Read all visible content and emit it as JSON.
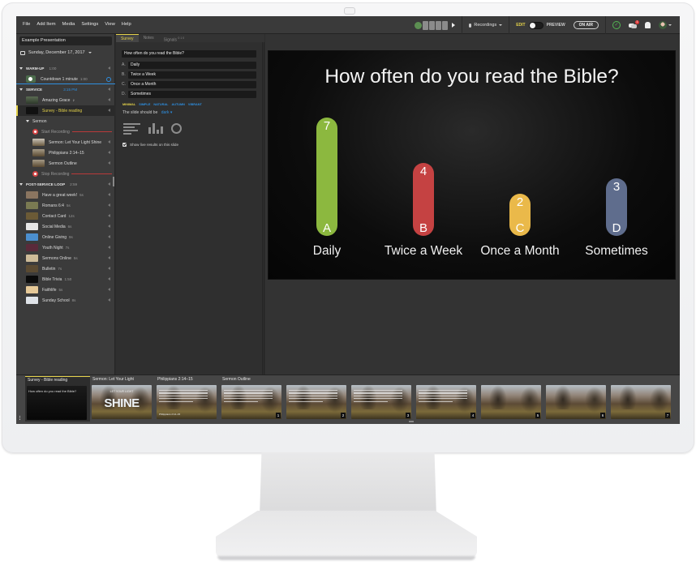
{
  "menu": [
    "File",
    "Add Item",
    "Media",
    "Settings",
    "View",
    "Help"
  ],
  "toolbar": {
    "recordings_label": "Recordings",
    "edit_label": "EDIT",
    "preview_label": "PREVIEW",
    "on_air_label": "ON AIR",
    "notification_count": "1",
    "status_icon": "check-circle-icon"
  },
  "sidebar": {
    "presentation_name": "Example Presentation",
    "date": "Sunday, December 17, 2017",
    "sections": {
      "warmup": {
        "title": "WARM-UP",
        "duration": "1:00",
        "items": [
          {
            "label": "Countdown 1 minute",
            "duration": "1:00"
          }
        ]
      },
      "service": {
        "title": "SERVICE",
        "time": "3:15 PM",
        "items": [
          {
            "label": "Amazing Grace",
            "suffix": "♪"
          },
          {
            "label": "Survey - Bible reading"
          }
        ],
        "sermon": {
          "title": "Sermon",
          "start_recording": "Start Recording",
          "items": [
            {
              "label": "Sermon: Let Your Light Shine"
            },
            {
              "label": "Philippians 2:14–15"
            },
            {
              "label": "Sermon Outline"
            }
          ],
          "stop_recording": "Stop Recording"
        }
      },
      "loop": {
        "title": "POST-SERVICE LOOP",
        "duration": "2:59",
        "items": [
          {
            "label": "Have a great week!",
            "duration": "5s",
            "color": "#8a7560"
          },
          {
            "label": "Romans 6:4",
            "duration": "5s",
            "color": "#7a7a52"
          },
          {
            "label": "Contact Card",
            "duration": "12s",
            "color": "#6b5a36"
          },
          {
            "label": "Social Media",
            "duration": "6s",
            "color": "#e6e6e6"
          },
          {
            "label": "Online Giving",
            "duration": "9s",
            "color": "#4b8fcf"
          },
          {
            "label": "Youth Night",
            "duration": "7s",
            "color": "#5a2a3a"
          },
          {
            "label": "Sermons Online",
            "duration": "5s",
            "color": "#cdbb98"
          },
          {
            "label": "Bulletin",
            "duration": "7s",
            "color": "#5a4a32"
          },
          {
            "label": "Bible Trivia",
            "duration": "1:50",
            "color": "#0a0a0a"
          },
          {
            "label": "Faithlife",
            "duration": "5s",
            "color": "#e6c998"
          },
          {
            "label": "Sunday School",
            "duration": "8s",
            "color": "#dfe3e8"
          }
        ]
      }
    }
  },
  "editor": {
    "tabs": [
      {
        "label": "Survey"
      },
      {
        "label": "Notes"
      },
      {
        "label": "Signals",
        "sup": "0 1 0"
      }
    ],
    "question": "How often do you read the Bible?",
    "options": [
      {
        "letter": "A.",
        "value": "Daily"
      },
      {
        "letter": "B.",
        "value": "Twice a Week"
      },
      {
        "letter": "C.",
        "value": "Once a Month"
      },
      {
        "letter": "D.",
        "value": "Sometimes"
      }
    ],
    "themes": [
      "MINIMAL",
      "SIMPLE",
      "NATURAL",
      "AUTUMN",
      "VIBRANT"
    ],
    "active_theme": "MINIMAL",
    "slide_should_be_label": "The slide should be",
    "slide_should_be_value": "dark",
    "show_live_results_label": "Show live results on this slide",
    "show_live_results_checked": true
  },
  "chart_data": {
    "type": "bar",
    "title": "How often do you read the Bible?",
    "categories": [
      "Daily",
      "Twice a Week",
      "Once a Month",
      "Sometimes"
    ],
    "letters": [
      "A",
      "B",
      "C",
      "D"
    ],
    "values": [
      7,
      4,
      2,
      3
    ],
    "colors": [
      "#8cb83f",
      "#c54242",
      "#eab94a",
      "#5f6d8d"
    ],
    "xlabel": "",
    "ylabel": "",
    "grid": false
  },
  "filmstrip": {
    "slots": [
      {
        "label": "Survey - Bible reading",
        "type": "black",
        "text": "How often do you read the Bible?"
      },
      {
        "label": "Sermon: Let Your Light",
        "type": "shine",
        "small": "LET YOUR LIGHT",
        "big": "SHINE"
      },
      {
        "label": "Philippians 2:14–15",
        "type": "text",
        "ref": "Philippians 2:14–15"
      },
      {
        "label": "Sermon Outline",
        "type": "text",
        "page": "1"
      },
      {
        "label": "",
        "type": "text",
        "page": "2"
      },
      {
        "label": "",
        "type": "text",
        "page": "3"
      },
      {
        "label": "",
        "type": "text",
        "page": "4"
      },
      {
        "label": "",
        "type": "photo",
        "page": "5"
      },
      {
        "label": "",
        "type": "photo",
        "page": "6"
      },
      {
        "label": "",
        "type": "photo",
        "page": "7"
      }
    ]
  }
}
